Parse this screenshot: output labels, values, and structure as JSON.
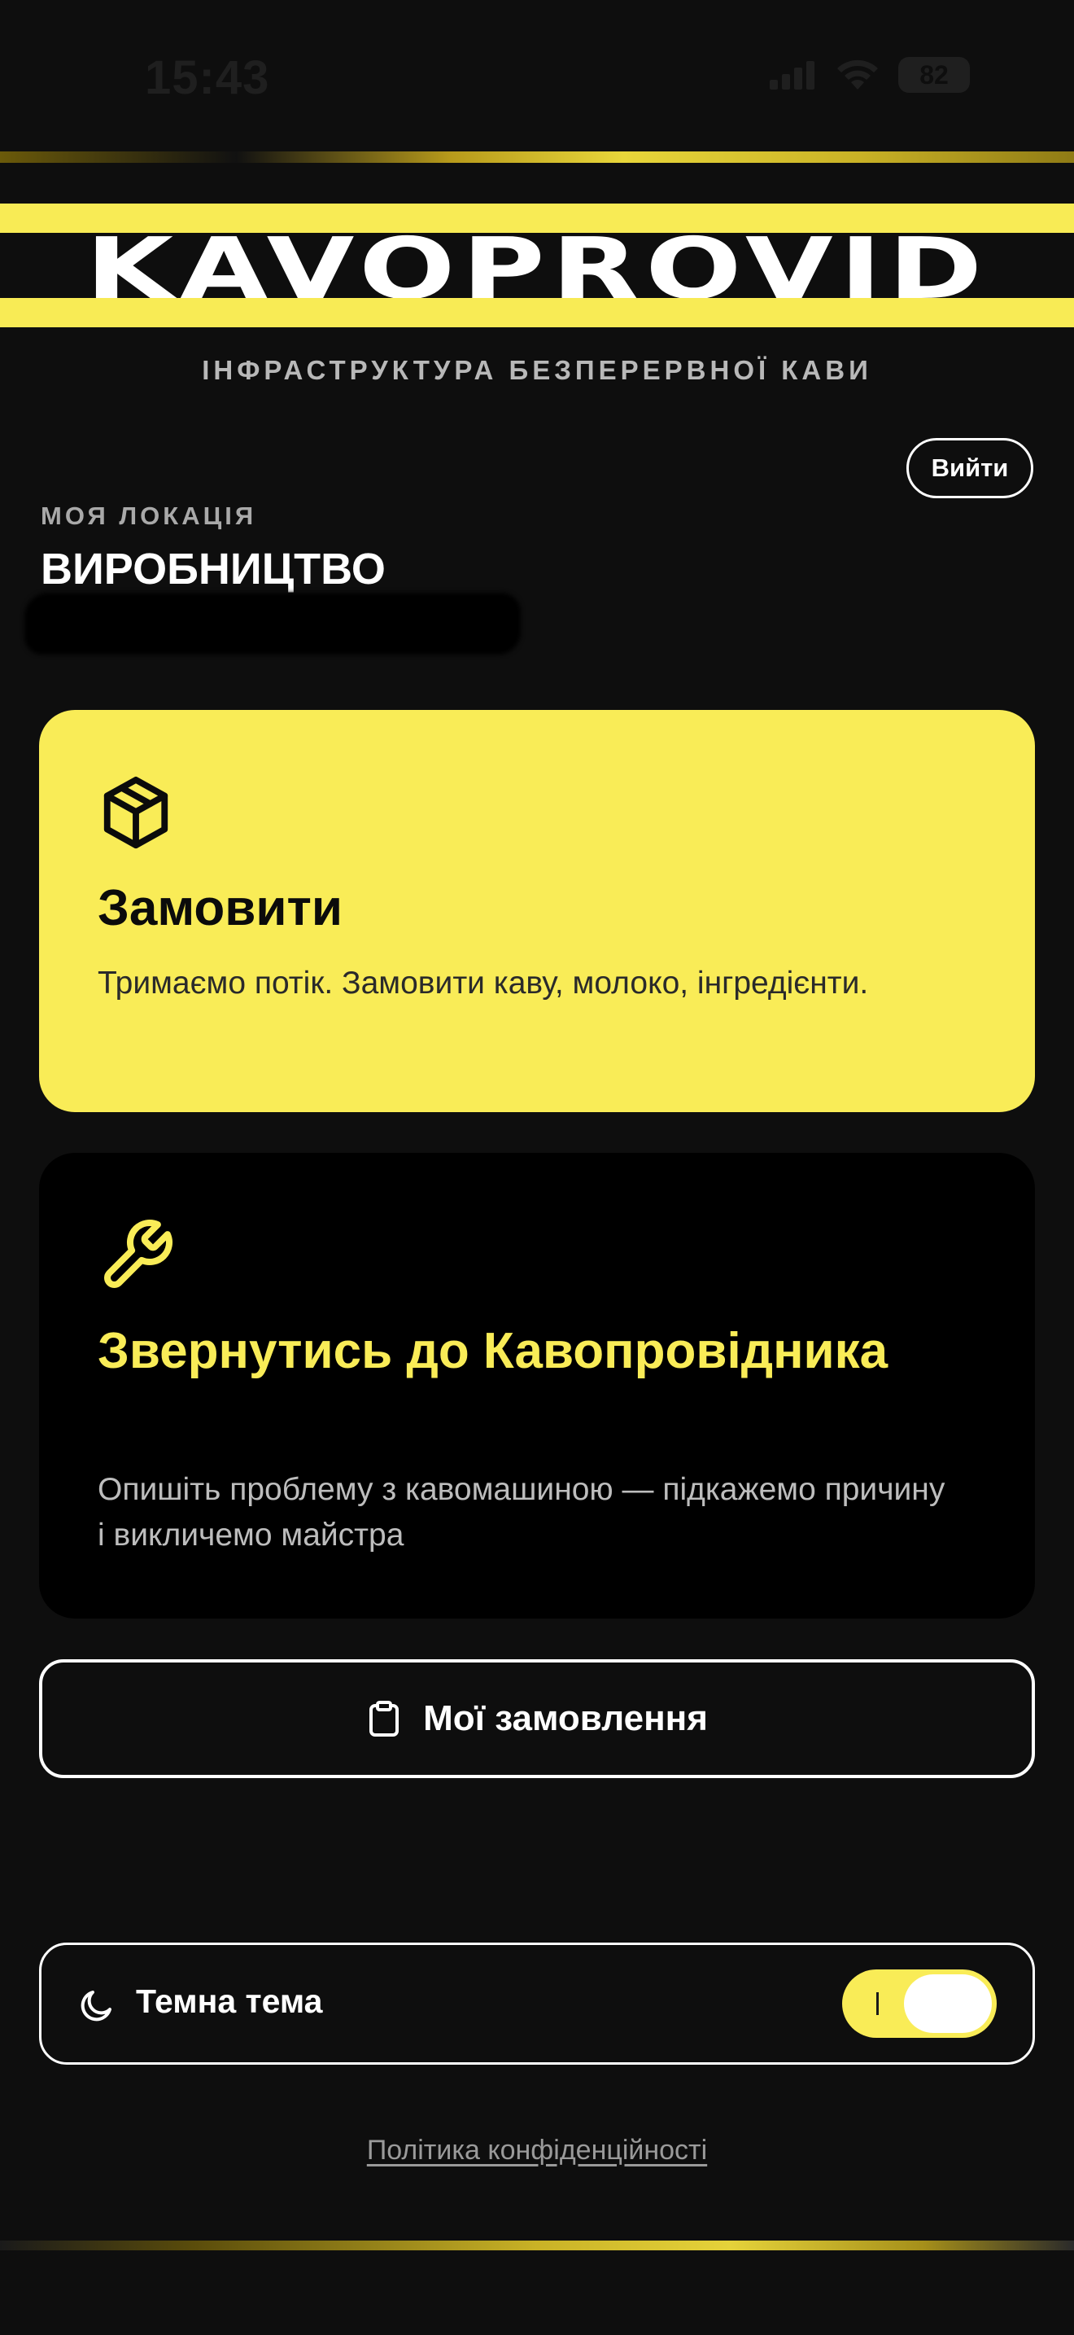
{
  "status_bar": {
    "time": "15:43",
    "battery": "82",
    "icons": [
      "cellular-signal-icon",
      "wifi-icon",
      "battery-icon"
    ]
  },
  "brand": {
    "logo_text": "KAVOPROVID",
    "tagline": "ІНФРАСТРУКТУРА БЕЗПЕРЕРВНОЇ КАВИ",
    "accent_color": "#f9ec57",
    "background_color": "#0e0e0e"
  },
  "header": {
    "logout_label": "Вийти"
  },
  "location": {
    "caption": "МОЯ ЛОКАЦІЯ",
    "name": "ВИРОБНИЦТВО"
  },
  "cards": {
    "order": {
      "icon": "package-icon",
      "title": "Замовити",
      "description": "Тримаємо потік. Замовити каву, молоко, інгредієнти."
    },
    "service": {
      "icon": "wrench-icon",
      "title": "Звернутись до Кавопровідника",
      "description": "Опишіть проблему з кавомашиною — підкажемо причину і викличемо майстра"
    }
  },
  "orders_button": {
    "icon": "clipboard-icon",
    "label": "Мої замовлення"
  },
  "theme": {
    "icon": "moon-icon",
    "label": "Темна тема",
    "enabled": true
  },
  "footer": {
    "privacy_link": "Політика конфіденційності"
  }
}
